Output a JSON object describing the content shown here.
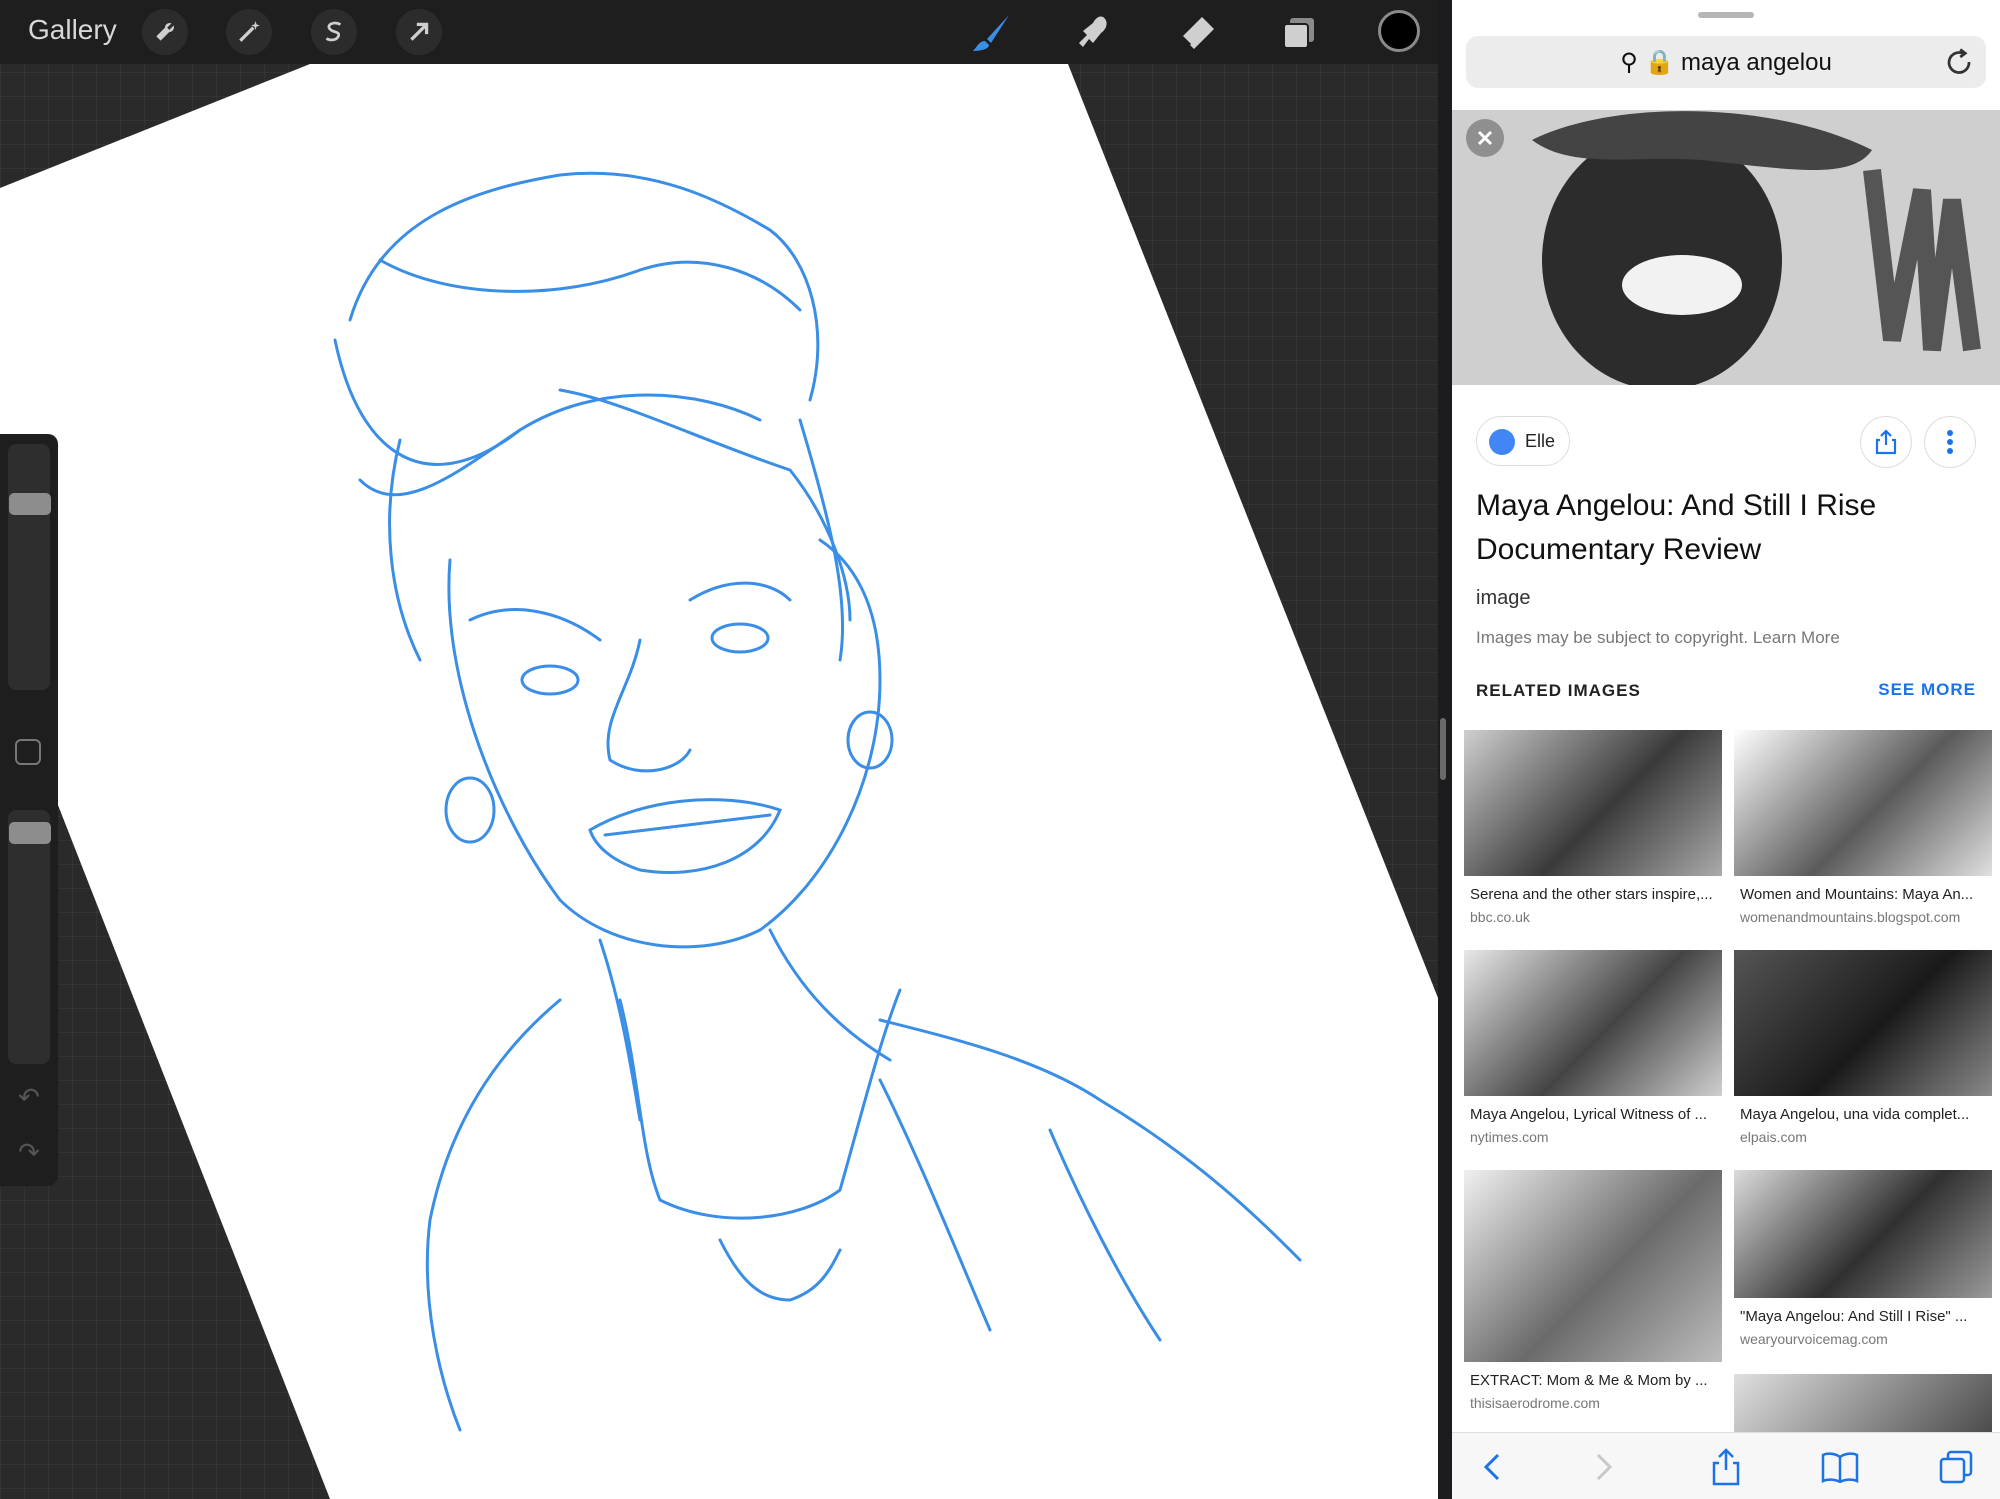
{
  "procreate": {
    "gallery_label": "Gallery",
    "toolbar_left_icons": [
      "wrench-icon",
      "magic-wand-icon",
      "selection-icon",
      "transform-arrow-icon"
    ],
    "toolbar_right_icons": [
      "brush-icon",
      "smudge-icon",
      "eraser-icon",
      "layers-icon"
    ],
    "current_color": "#000000",
    "stroke_color": "#3a8ee6",
    "brush_size_level": 0.22,
    "opacity_level": 0.05
  },
  "safari": {
    "url": "maya angelou",
    "source_name": "Elle",
    "result_title": "Maya Angelou: And Still I Rise Documentary Review",
    "result_type": "image",
    "copyright_note": "Images may be subject to copyright. Learn More",
    "related_heading": "RELATED IMAGES",
    "see_more": "SEE MORE",
    "related": [
      {
        "caption": "Serena and the other stars inspire,...",
        "source": "bbc.co.uk"
      },
      {
        "caption": "Women and Mountains: Maya An...",
        "source": "womenandmountains.blogspot.com"
      },
      {
        "caption": "Maya Angelou, Lyrical Witness of ...",
        "source": "nytimes.com"
      },
      {
        "caption": "Maya Angelou, una vida complet...",
        "source": "elpais.com"
      },
      {
        "caption": "EXTRACT: Mom & Me & Mom by ...",
        "source": "thisisaerodrome.com"
      },
      {
        "caption": "\"Maya Angelou: And Still I Rise\" ...",
        "source": "wearyourvoicemag.com"
      }
    ],
    "bottom_icons": [
      "back-icon",
      "forward-icon",
      "share-icon",
      "bookmarks-icon",
      "tabs-icon"
    ]
  }
}
